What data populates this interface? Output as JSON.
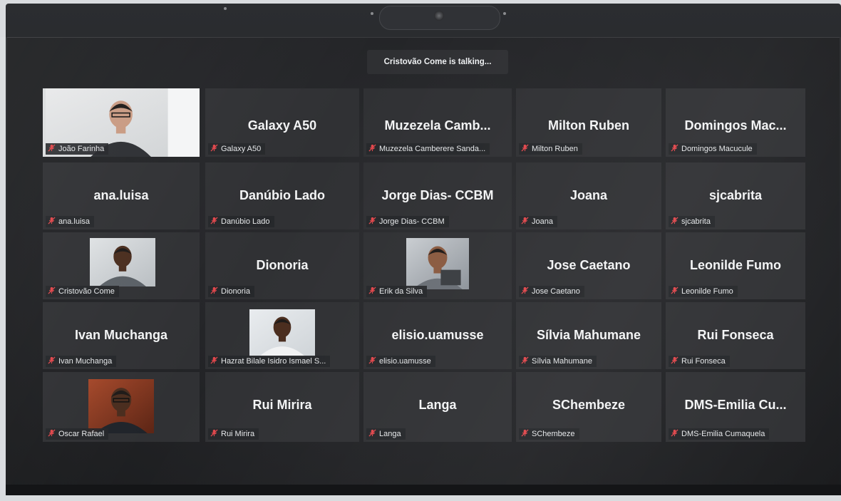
{
  "meeting": {
    "talking_banner": "Cristovão Come is talking..."
  },
  "participants": [
    {
      "display": "",
      "label": "João Farinha",
      "video": true
    },
    {
      "display": "Galaxy A50",
      "label": "Galaxy A50",
      "video": false
    },
    {
      "display": "Muzezela  Camb...",
      "label": "Muzezela Camberere Sanda...",
      "video": false
    },
    {
      "display": "Milton Ruben",
      "label": "Milton Ruben",
      "video": false
    },
    {
      "display": "Domingos  Mac...",
      "label": "Domingos Macucule",
      "video": false
    },
    {
      "display": "ana.luisa",
      "label": "ana.luisa",
      "video": false
    },
    {
      "display": "Danúbio Lado",
      "label": "Danúbio Lado",
      "video": false
    },
    {
      "display": "Jorge Dias- CCBM",
      "label": "Jorge Dias- CCBM",
      "video": false
    },
    {
      "display": "Joana",
      "label": "Joana",
      "video": false
    },
    {
      "display": "sjcabrita",
      "label": "sjcabrita",
      "video": false
    },
    {
      "display": "",
      "label": "Cristovão Come",
      "video": true
    },
    {
      "display": "Dionoria",
      "label": "Dionoria",
      "video": false
    },
    {
      "display": "",
      "label": "Erik da Silva",
      "video": true
    },
    {
      "display": "Jose Caetano",
      "label": "Jose Caetano",
      "video": false
    },
    {
      "display": "Leonilde Fumo",
      "label": "Leonilde Fumo",
      "video": false
    },
    {
      "display": "Ivan Muchanga",
      "label": "Ivan Muchanga",
      "video": false
    },
    {
      "display": "",
      "label": "Hazrat Bilale Isidro Ismael S...",
      "video": true
    },
    {
      "display": "elisio.uamusse",
      "label": "elisio.uamusse",
      "video": false
    },
    {
      "display": "Sílvia Mahumane",
      "label": "Sílvia Mahumane",
      "video": false
    },
    {
      "display": "Rui Fonseca",
      "label": "Rui Fonseca",
      "video": false
    },
    {
      "display": "",
      "label": "Oscar Rafael",
      "video": true
    },
    {
      "display": "Rui Mirira",
      "label": "Rui Mirira",
      "video": false
    },
    {
      "display": "Langa",
      "label": "Langa",
      "video": false
    },
    {
      "display": "SChembeze",
      "label": "SChembeze",
      "video": false
    },
    {
      "display": "DMS-Emilia  Cu...",
      "label": "DMS-Emilia Cumaquela",
      "video": false
    }
  ],
  "icons": {
    "muted_mic": "muted-mic-icon",
    "muted_color": "#e0474c"
  }
}
